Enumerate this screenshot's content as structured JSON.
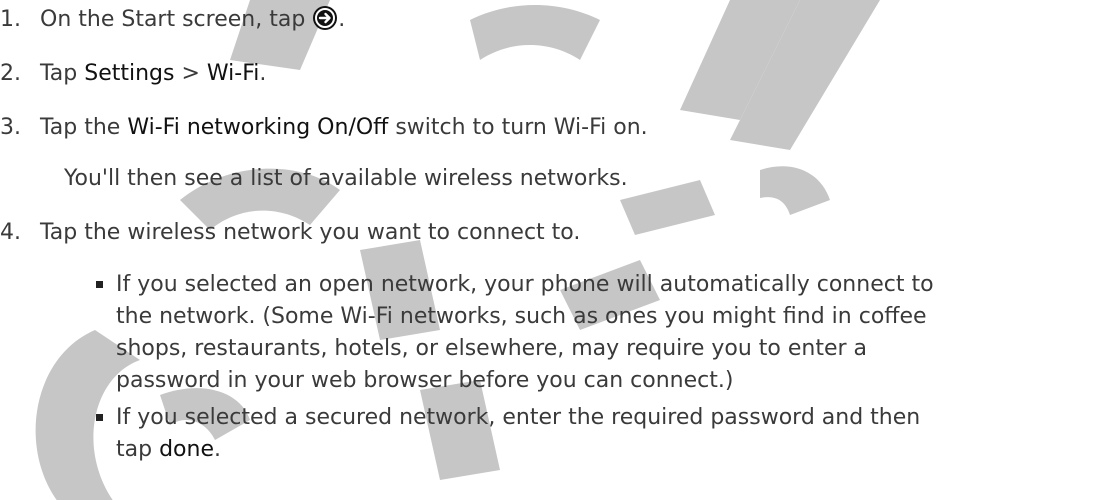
{
  "watermark": {
    "line1": "Controlled",
    "line2": "Certification",
    "color": "#c6c6c6"
  },
  "steps": [
    {
      "number": "1.",
      "before": "On the Start screen, tap ",
      "after": "."
    },
    {
      "number": "2.",
      "text_a": "Tap ",
      "bold_a": "Settings",
      "text_b": " > ",
      "bold_b": "Wi-Fi",
      "text_c": "."
    },
    {
      "number": "3.",
      "text_a": "Tap the ",
      "bold_a": "Wi-Fi networking On/Off",
      "text_b": " switch to turn Wi-Fi on."
    },
    {
      "number": "4.",
      "text": "Tap the wireless network you want to connect to."
    }
  ],
  "step3_note": "You'll then see a list of available wireless networks.",
  "bullets": [
    {
      "text": "If you selected an open network, your phone will automatically connect to\nthe network. (Some Wi-Fi networks, such as ones you might find in coffee\nshops, restaurants, hotels, or elsewhere, may require you to enter a\npassword in your web browser before you can connect.)"
    },
    {
      "text_a": "If you selected a secured network, enter the required password and then\ntap ",
      "bold_a": "done",
      "text_b": "."
    }
  ],
  "icon": "arrow-right-circle-icon"
}
